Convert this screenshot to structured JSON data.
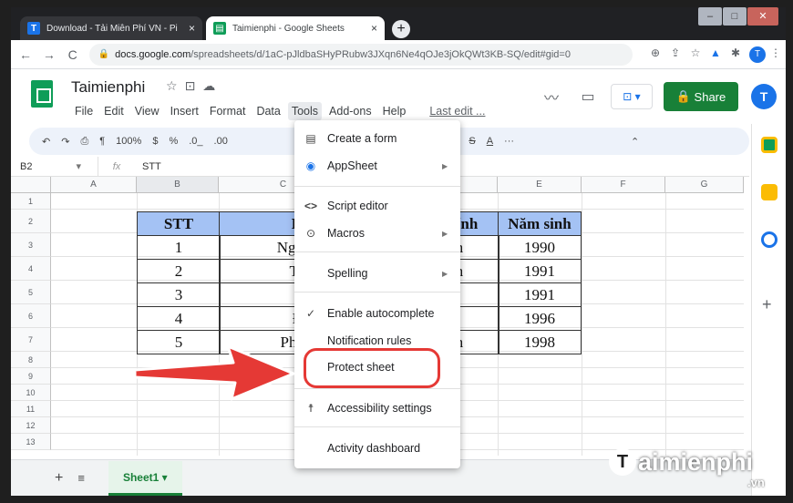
{
  "browser": {
    "tabs": [
      {
        "favicon": "T",
        "favicon_color": "#1a73e8",
        "title": "Download - Tải Miễn Phí VN - Pi",
        "close": "×"
      },
      {
        "favicon": "▤",
        "favicon_color": "#0f9d58",
        "title": "Taimienphi - Google Sheets",
        "close": "×"
      }
    ],
    "new_tab": "+",
    "window_controls": [
      "–",
      "□",
      "✕"
    ],
    "url_host": "docs.google.com",
    "url_path": "/spreadsheets/d/1aC-pJldbaSHyPRubw3JXqn6Ne4qOJe3jOkQWt3KB-SQ/edit#gid=0",
    "profile_letter": "T"
  },
  "sheets": {
    "title": "Taimienphi",
    "menu": [
      "File",
      "Edit",
      "View",
      "Insert",
      "Format",
      "Data",
      "Tools",
      "Add-ons",
      "Help"
    ],
    "last_edit": "Last edit ...",
    "share_label": "Share",
    "avatar_letter": "T",
    "toolbar": {
      "zoom": "100%",
      "currency": "$",
      "percent": "%",
      "dec1": ".0_",
      "dec2": ".00",
      "bold": "B",
      "italic": "I",
      "strike": "S",
      "textcolor": "A",
      "more": "···"
    },
    "name_box": "B2",
    "fx_label": "fx",
    "formula_value": "STT",
    "columns": [
      "A",
      "B",
      "C",
      "D",
      "E",
      "F",
      "G"
    ],
    "rows": [
      "1",
      "2",
      "3",
      "4",
      "5",
      "6",
      "7",
      "8",
      "9",
      "10",
      "11",
      "12",
      "13"
    ],
    "table": {
      "headers": [
        "STT",
        "H",
        "tính",
        "Năm sinh"
      ],
      "rows": [
        [
          "1",
          "Ngu",
          "m",
          "1990"
        ],
        [
          "2",
          "Tr",
          "m",
          "1991"
        ],
        [
          "3",
          "L",
          "ữ",
          "1991"
        ],
        [
          "4",
          "Đ",
          "ữ",
          "1996"
        ],
        [
          "5",
          "Pha",
          "m",
          "1998"
        ]
      ]
    },
    "sheet_tab": "Sheet1 ▾",
    "add_sheet": "+",
    "all_sheets": "≡"
  },
  "tools_menu": {
    "items": [
      {
        "icon": "form-icon",
        "glyph": "▤",
        "label": "Create a form"
      },
      {
        "icon": "appsheet-icon",
        "glyph": "◉",
        "label": "AppSheet",
        "submenu": true
      },
      {
        "icon": "code-icon",
        "glyph": "<>",
        "label": "Script editor"
      },
      {
        "icon": "macro-icon",
        "glyph": "⊙",
        "label": "Macros",
        "submenu": true
      },
      {
        "icon": "",
        "glyph": "",
        "label": "Spelling",
        "submenu": true
      },
      {
        "icon": "check-icon",
        "glyph": "✓",
        "label": "Enable autocomplete"
      },
      {
        "icon": "",
        "glyph": "",
        "label": "Notification rules"
      },
      {
        "icon": "",
        "glyph": "",
        "label": "Protect sheet"
      },
      {
        "icon": "accessibility-icon",
        "glyph": "☨",
        "label": "Accessibility settings"
      },
      {
        "icon": "",
        "glyph": "",
        "label": "Activity dashboard"
      }
    ],
    "submenu_arrow": "▶"
  },
  "colors": {
    "accent": "#1a73e8",
    "share_green": "#188038",
    "header_fill": "#a4c2f4",
    "highlight_red": "#e53935"
  },
  "watermark": {
    "logo_letter": "T",
    "text": "aimienphi",
    "sub": ".vn"
  }
}
